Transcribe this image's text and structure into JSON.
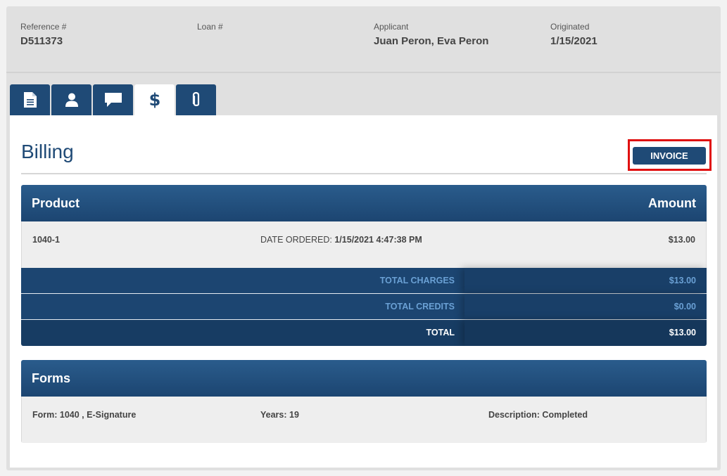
{
  "header": {
    "reference": {
      "label": "Reference #",
      "value": "D511373"
    },
    "loan": {
      "label": "Loan #",
      "value": ""
    },
    "applicant": {
      "label": "Applicant",
      "value": "Juan Peron, Eva Peron"
    },
    "originated": {
      "label": "Originated",
      "value": "1/15/2021"
    }
  },
  "tabs": [
    {
      "icon": "document-icon",
      "active": false
    },
    {
      "icon": "user-icon",
      "active": false
    },
    {
      "icon": "chat-icon",
      "active": false
    },
    {
      "icon": "dollar-icon",
      "active": true
    },
    {
      "icon": "paperclip-icon",
      "active": false
    }
  ],
  "billing": {
    "title": "Billing",
    "invoice_label": "INVOICE",
    "product_header": "Product",
    "amount_header": "Amount",
    "items": [
      {
        "product": "1040-1",
        "date_label": "DATE ORDERED:",
        "date_value": "1/15/2021 4:47:38 PM",
        "amount": "$13.00"
      }
    ],
    "totals": [
      {
        "label": "TOTAL CHARGES",
        "amount": "$13.00"
      },
      {
        "label": "TOTAL CREDITS",
        "amount": "$0.00"
      },
      {
        "label": "TOTAL",
        "amount": "$13.00"
      }
    ]
  },
  "forms": {
    "title": "Forms",
    "items": [
      {
        "form_label": "Form:",
        "form_value": "1040 , E-Signature",
        "years_label": "Years:",
        "years_value": "19",
        "desc_label": "Description:",
        "desc_value": "Completed"
      }
    ]
  },
  "colors": {
    "primary": "#1f4a76",
    "highlight_outline": "#e01010",
    "total_label": "#6aa0d4"
  }
}
